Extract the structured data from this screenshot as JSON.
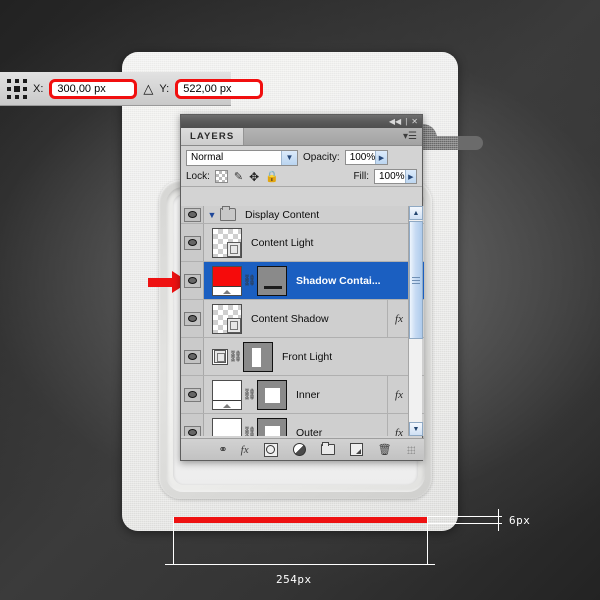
{
  "toolbar": {
    "refpoint_icon": "reference-point-grid",
    "x_label": "X:",
    "x_value": "300,00 px",
    "delta_icon": "△",
    "y_label": "Y:",
    "y_value": "522,00 px"
  },
  "panel": {
    "titlebar": {
      "collapse_icon": "◀◀",
      "divider": "|",
      "close_icon": "✕"
    },
    "tab": {
      "label": "LAYERS",
      "menu_icon": "▾☰"
    },
    "blend": {
      "mode_value": "Normal",
      "mode_chevron": "▼",
      "opacity_label": "Opacity:",
      "opacity_value": "100%",
      "opacity_chevron": "▶"
    },
    "lock": {
      "label": "Lock:",
      "icons": [
        "lock-transparency-icon",
        "lock-image-icon",
        "lock-position-icon",
        "lock-all-icon"
      ],
      "fill_label": "Fill:",
      "fill_value": "100%",
      "fill_chevron": "▶"
    },
    "layers": [
      {
        "name": "Display Content",
        "type": "group",
        "visible": true,
        "selected": false,
        "fx": false,
        "disclosure": "▼"
      },
      {
        "name": "Content Light",
        "type": "layer",
        "visible": true,
        "selected": false,
        "fx": false,
        "thumb": "checker-doc"
      },
      {
        "name": "Shadow Contai...",
        "type": "layer",
        "visible": true,
        "selected": true,
        "fx": false,
        "thumb": "red-screen",
        "mask": "gray-bar",
        "linked": true
      },
      {
        "name": "Content Shadow",
        "type": "layer",
        "visible": true,
        "selected": false,
        "fx": true,
        "thumb": "checker-doc"
      },
      {
        "name": "Front Light",
        "type": "layer",
        "visible": true,
        "selected": false,
        "fx": false,
        "thumb": "doc-badge",
        "mask": "gray-rect",
        "linked": true
      },
      {
        "name": "Inner",
        "type": "layer",
        "visible": true,
        "selected": false,
        "fx": true,
        "thumb": "white-screen",
        "mask": "gray-square",
        "linked": true
      },
      {
        "name": "Outer",
        "type": "layer",
        "visible": true,
        "selected": false,
        "fx": true,
        "thumb": "white-screen",
        "mask": "gray-square",
        "linked": true
      }
    ],
    "fx_label": "fx",
    "fx_arrow": "▾",
    "scrollbar": {
      "up_icon": "▲",
      "down_icon": "▼"
    },
    "bottom_icons": [
      "link-layers-icon",
      "layer-style-fx-icon",
      "add-layer-mask-icon",
      "adjustment-layer-icon",
      "new-group-icon",
      "new-layer-icon",
      "delete-layer-icon"
    ],
    "bottom_fx_label": "fx"
  },
  "annotations": {
    "width_measure": "254px",
    "height_measure": "6px",
    "arrow_icon": "right-arrow-pointer",
    "accent_red": "#ee1111",
    "selection_blue": "#1b5fc1"
  }
}
